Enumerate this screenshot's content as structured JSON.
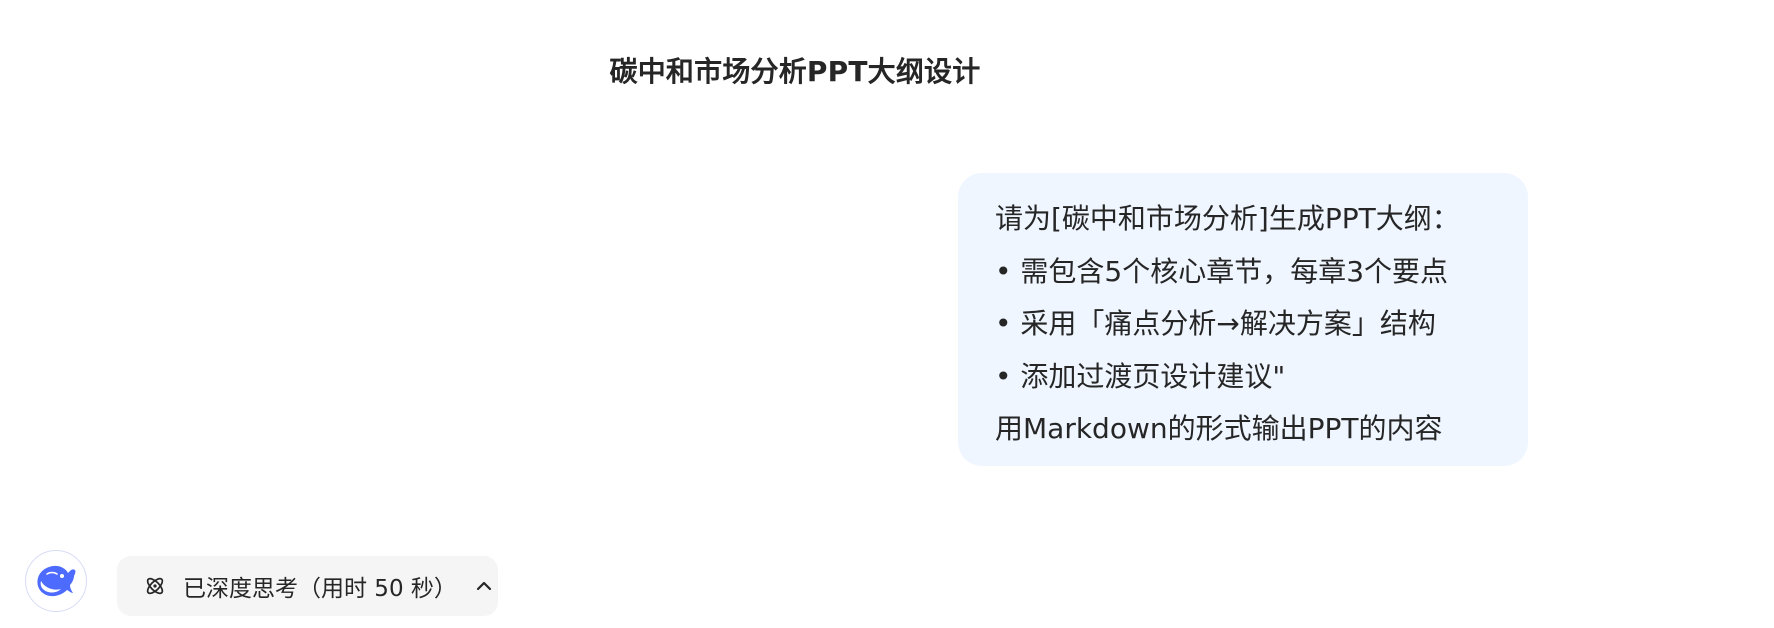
{
  "header": {
    "title": "碳中和市场分析PPT大纲设计"
  },
  "conversation": {
    "user_message": {
      "lines": [
        "请为[碳中和市场分析]生成PPT大纲：",
        "• 需包含5个核心章节，每章3个要点",
        "• 采用「痛点分析→解决方案」结构",
        "• 添加过渡页设计建议\"",
        "用Markdown的形式输出PPT的内容"
      ]
    },
    "assistant": {
      "avatar_icon": "whale-logo-icon",
      "thinking_toggle": {
        "icon": "atom-icon",
        "label": "已深度思考（用时 50 秒）",
        "chevron_icon": "chevron-up-icon"
      }
    }
  },
  "colors": {
    "bubble_bg": "#eff6ff",
    "brand_blue": "#4d6bfe",
    "toggle_bg": "#f5f5f5",
    "text": "#262626"
  }
}
